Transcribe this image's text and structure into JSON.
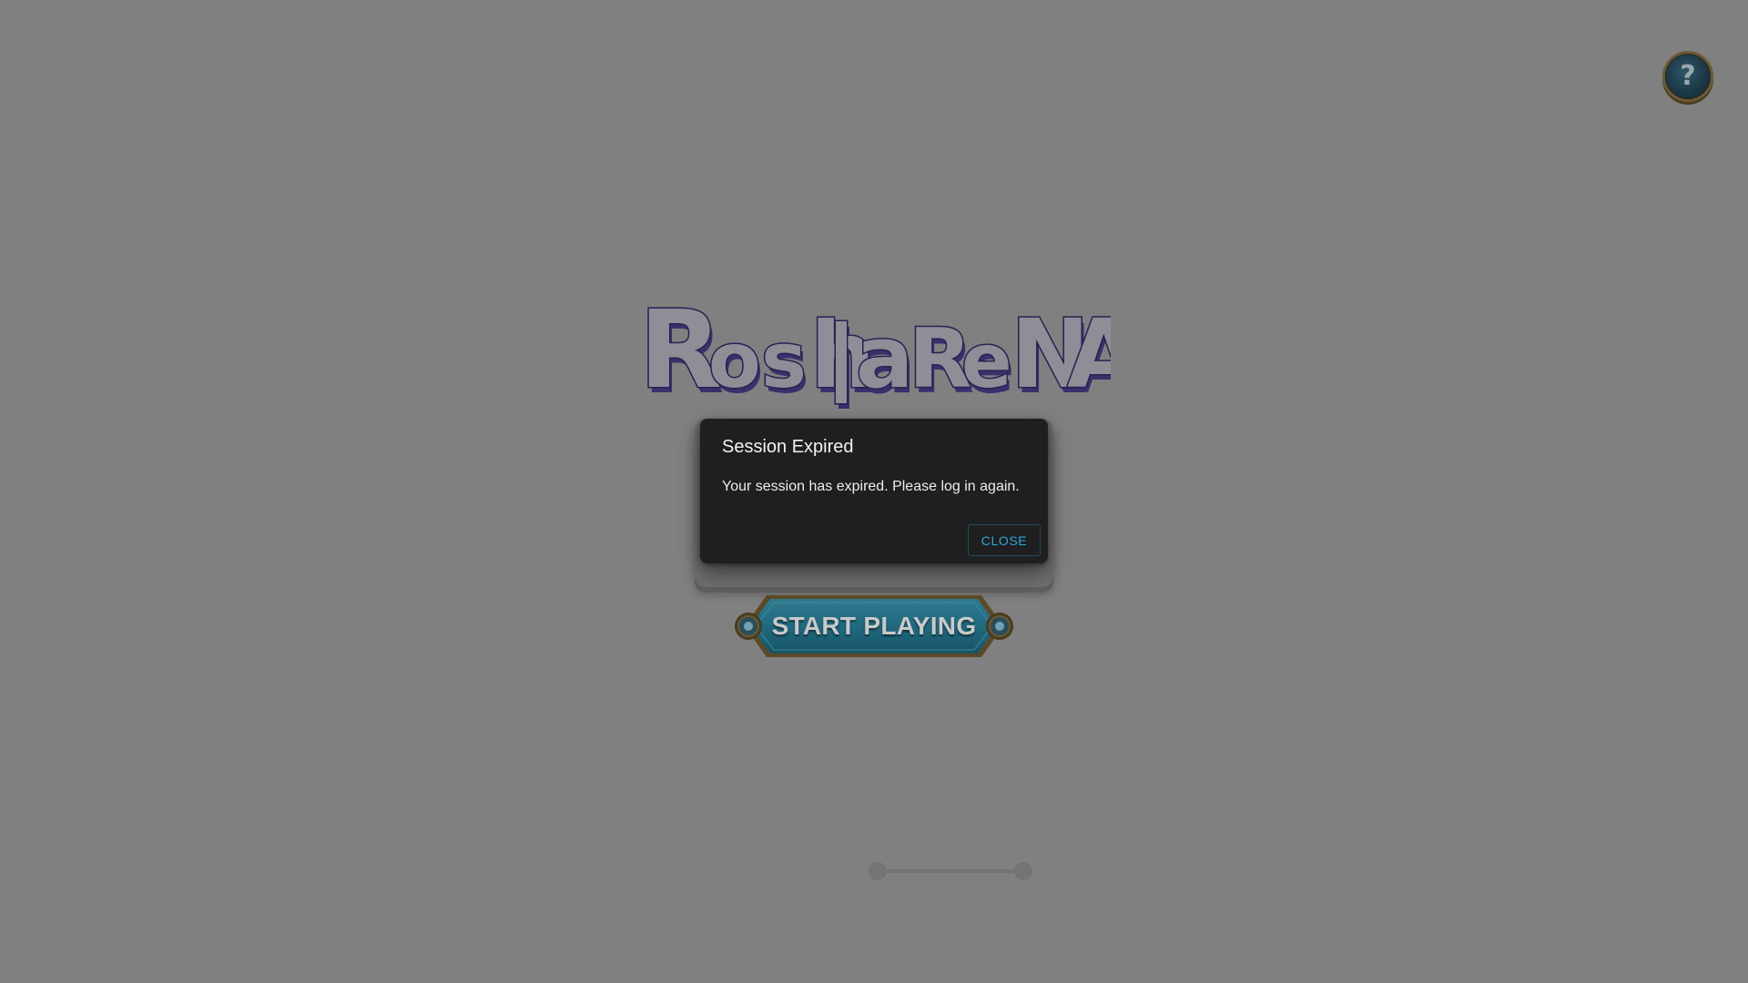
{
  "logo": {
    "text": "Rosh | arena"
  },
  "help": {
    "label": "?",
    "icon": "question-mark-icon"
  },
  "dialog": {
    "title": "Session Expired",
    "message": "Your session has expired. Please log in again.",
    "close_label": "CLOSE"
  },
  "start": {
    "label": "START PLAYING"
  },
  "slider": {
    "min_value": 0,
    "max_value": 1
  },
  "colors": {
    "overlay": "#808080",
    "dialog_bg": "#1f1f1f",
    "accent": "#29a8dd",
    "logo_outline": "#3a2f6b"
  }
}
